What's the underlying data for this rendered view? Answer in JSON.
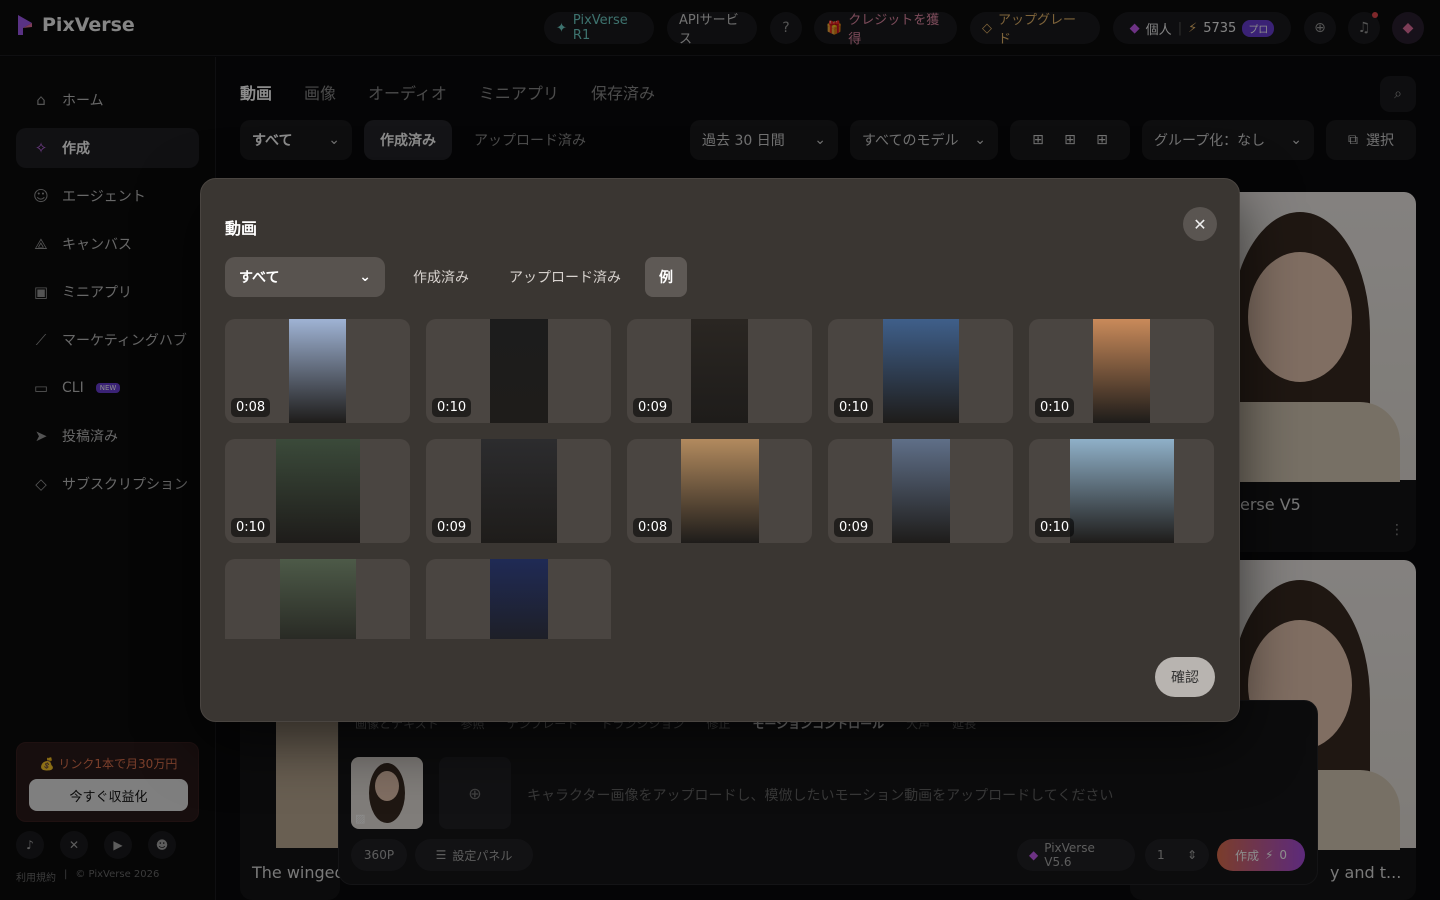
{
  "app": {
    "name": "PixVerse"
  },
  "topbar": {
    "r1_label": "PixVerse R1",
    "api_label": "APIサービス",
    "credits_label": "クレジットを獲得",
    "upgrade_label": "アップグレード",
    "account_label": "個人",
    "credit_count": "5735",
    "plan_badge": "プロ"
  },
  "sidebar": {
    "items": [
      {
        "label": "ホーム",
        "icon": "home-icon"
      },
      {
        "label": "作成",
        "icon": "sparkle-icon"
      },
      {
        "label": "エージェント",
        "icon": "robot-icon"
      },
      {
        "label": "キャンバス",
        "icon": "canvas-icon"
      },
      {
        "label": "ミニアプリ",
        "icon": "cube-icon"
      },
      {
        "label": "マーケティングハブ",
        "icon": "chart-icon"
      },
      {
        "label": "CLI",
        "icon": "terminal-icon",
        "badge": "NEW"
      },
      {
        "label": "投稿済み",
        "icon": "send-icon"
      },
      {
        "label": "サブスクリプション",
        "icon": "diamond-icon"
      }
    ],
    "promo_text": "💰 リンク1本で月30万円",
    "promo_button": "今すぐ収益化",
    "footer_terms": "利用規約",
    "footer_copyright": "© PixVerse 2026"
  },
  "main": {
    "tabs": [
      "動画",
      "画像",
      "オーディオ",
      "ミニアプリ",
      "保存済み"
    ],
    "filter_all": "すべて",
    "filter_created": "作成済み",
    "filter_uploaded": "アップロード済み",
    "filter_period": "過去 30 日間",
    "filter_model": "すべてのモデル",
    "filter_group": "グループ化：なし",
    "select_label": "選択",
    "card_caption_1": "erse V5",
    "card_caption_2": "The winged",
    "card_caption_3": "y and t..."
  },
  "composer": {
    "tabs": [
      "画像とテキスト",
      "参照",
      "テンプレート",
      "トランジション",
      "修正",
      "モーションコントロール",
      "大声",
      "延長"
    ],
    "placeholder": "キャラクター画像をアップロードし、模倣したいモーション動画をアップロードしてください",
    "resolution": "360P",
    "settings_label": "設定パネル",
    "model_label": "PixVerse V5.6",
    "count": "1",
    "create_label": "作成",
    "create_cost": "0"
  },
  "modal": {
    "title": "動画",
    "select_value": "すべて",
    "tab_created": "作成済み",
    "tab_uploaded": "アップロード済み",
    "tab_examples": "例",
    "confirm_label": "確認",
    "videos": [
      {
        "duration": "0:08",
        "color": "#9fb3d4"
      },
      {
        "duration": "0:10",
        "color": "#1c1c1c"
      },
      {
        "duration": "0:09",
        "color": "#2a2622"
      },
      {
        "duration": "0:10",
        "color": "#3f5f8a"
      },
      {
        "duration": "0:10",
        "color": "#c98a5a"
      },
      {
        "duration": "0:10",
        "color": "#3b4a3a"
      },
      {
        "duration": "0:09",
        "color": "#2c2c2e"
      },
      {
        "duration": "0:08",
        "color": "#b28a5e"
      },
      {
        "duration": "0:09",
        "color": "#5f6f88"
      },
      {
        "duration": "0:10",
        "color": "#8fb0c8"
      },
      {
        "duration": "",
        "color": "#4d5a48"
      },
      {
        "duration": "",
        "color": "#1f2a55"
      }
    ]
  }
}
